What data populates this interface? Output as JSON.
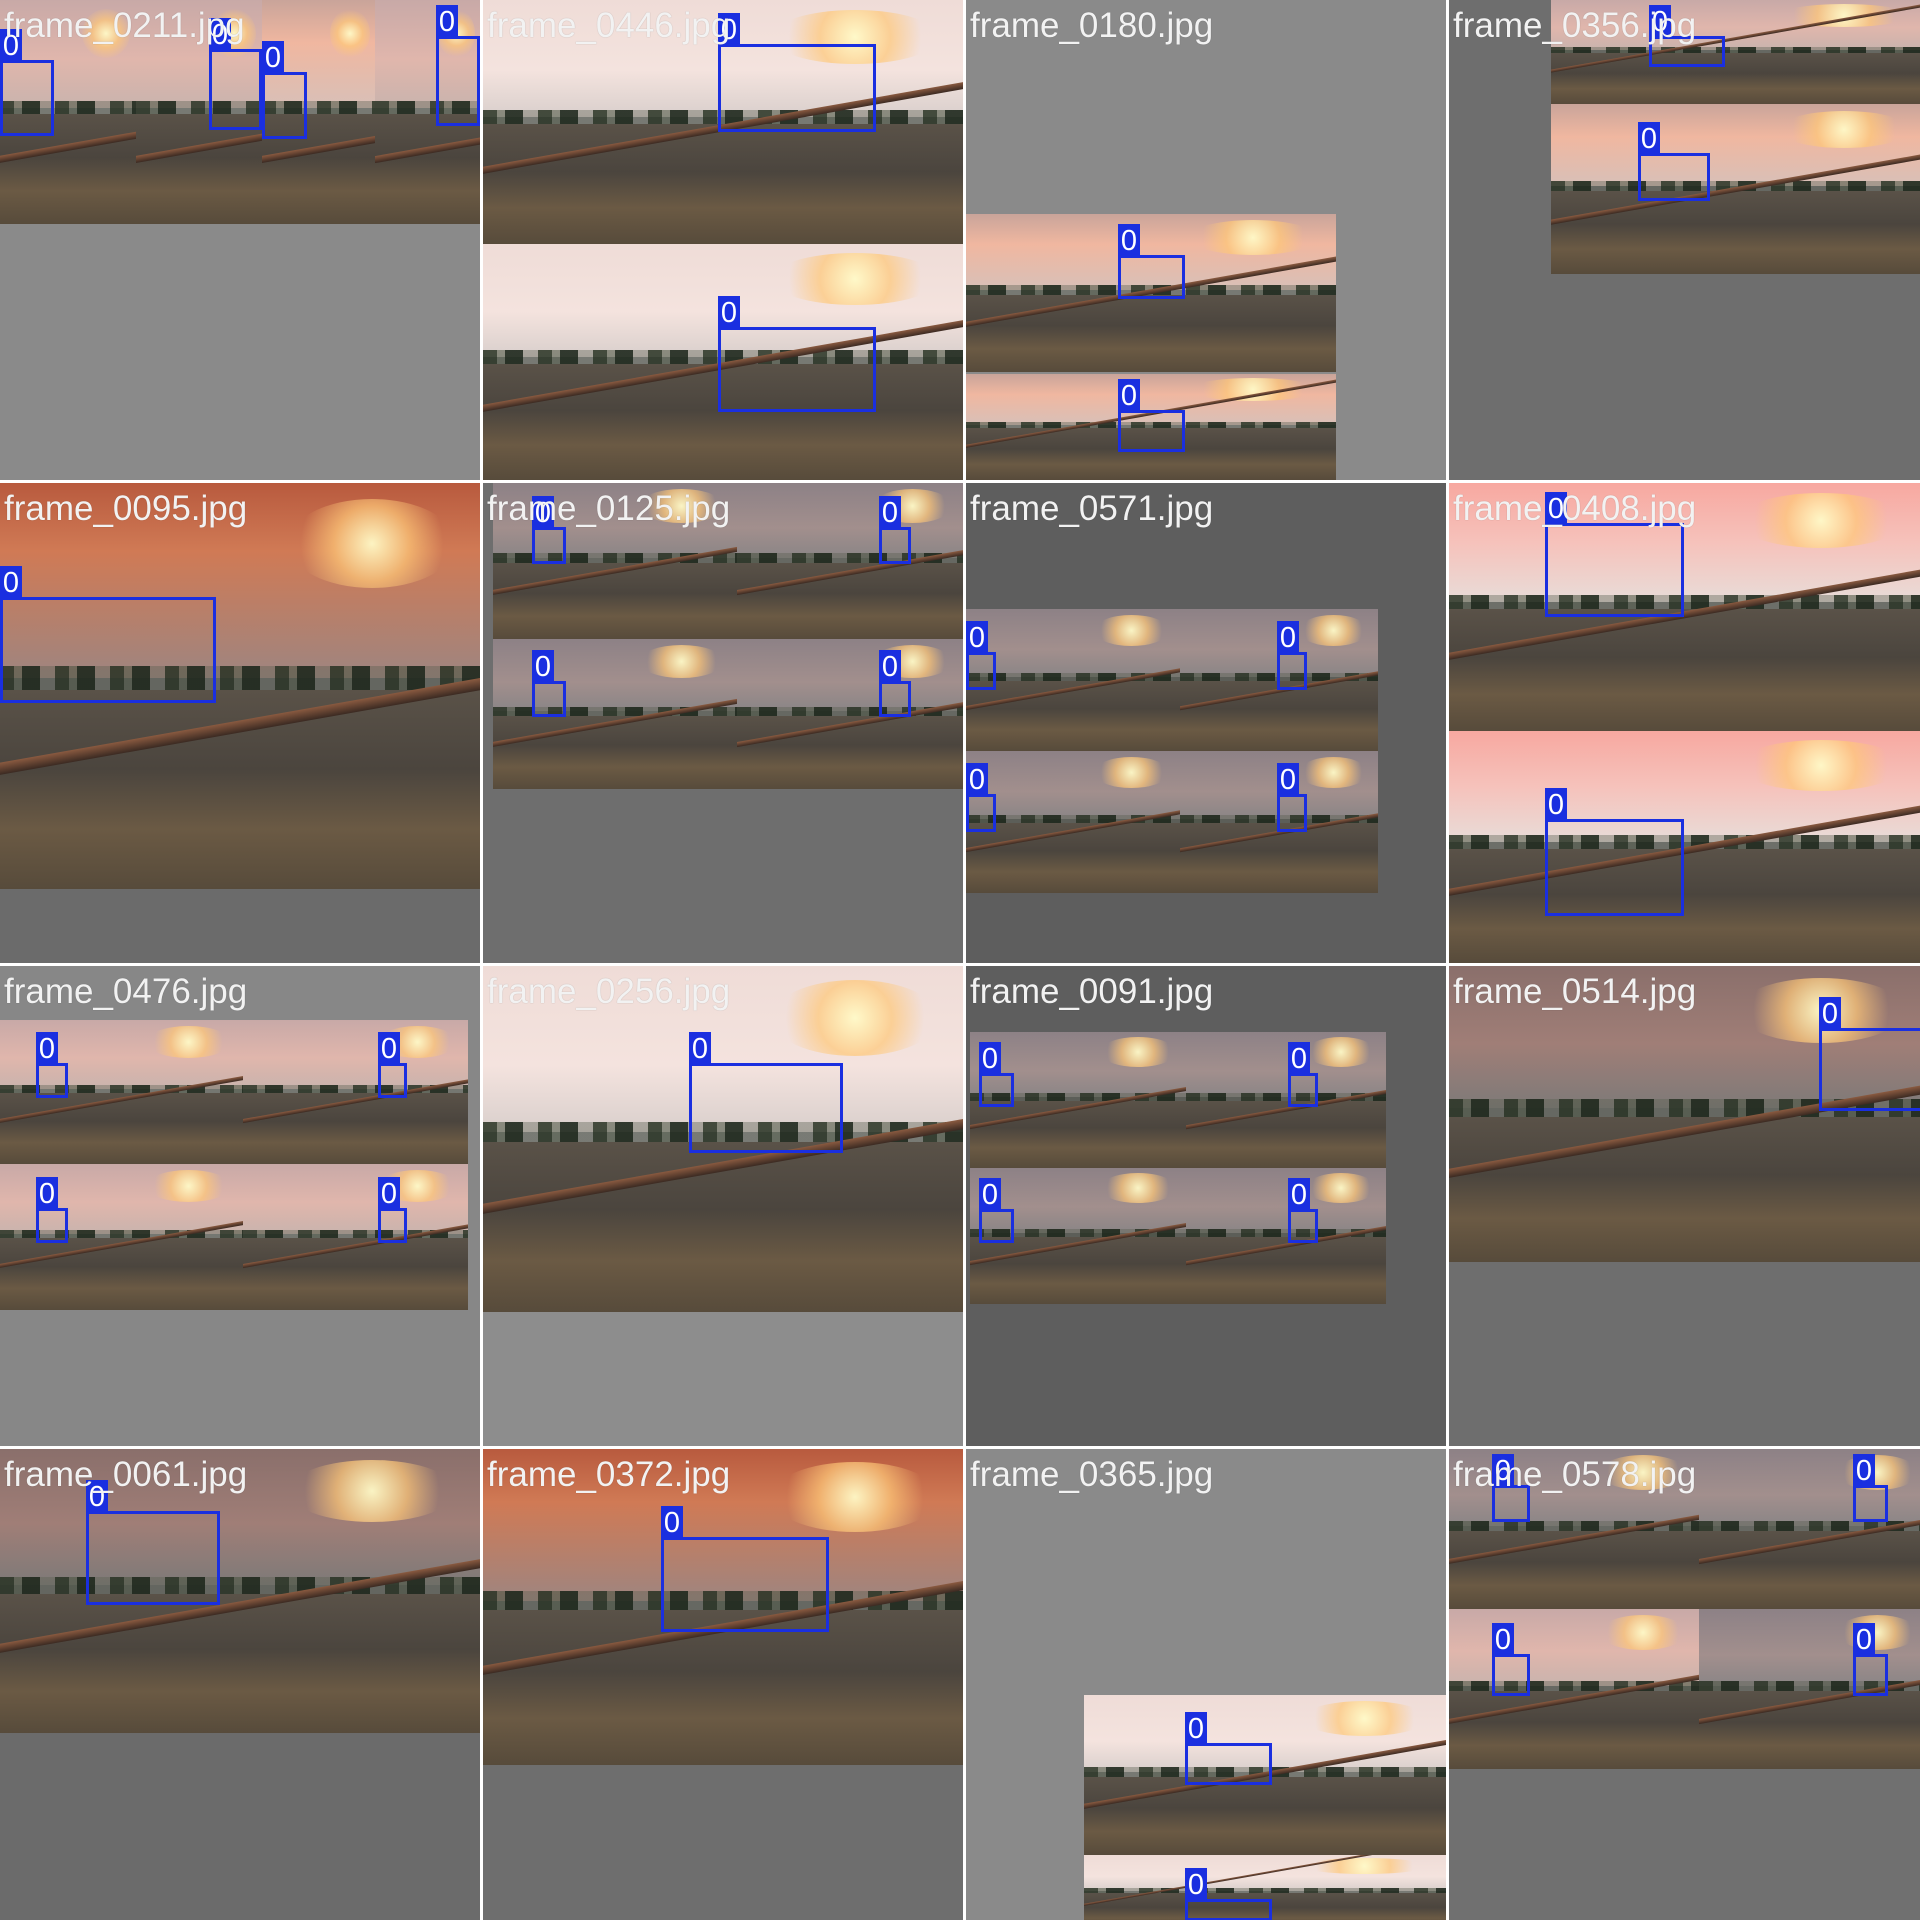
{
  "grid": {
    "columns": 4,
    "rows": 4,
    "tiles": [
      {
        "label": "frame_0211.jpg",
        "tint": "#8a8a8a",
        "photos": [
          {
            "sky": "warm",
            "boxes": [
              {
                "cls": "0"
              }
            ]
          },
          {
            "sky": "warm",
            "boxes": [
              {
                "cls": "0"
              }
            ]
          },
          {
            "sky": "sunset",
            "boxes": [
              {
                "cls": "0"
              }
            ]
          },
          {
            "sky": "warm",
            "boxes": [
              {
                "cls": "0"
              }
            ]
          }
        ]
      },
      {
        "label": "frame_0446.jpg",
        "tint": "#8a8a8a",
        "photos": [
          {
            "sky": "pale",
            "boxes": [
              {
                "cls": "0"
              }
            ]
          },
          {
            "sky": "pale",
            "boxes": [
              {
                "cls": "0"
              }
            ]
          }
        ]
      },
      {
        "label": "frame_0180.jpg",
        "tint": "#8a8a8a",
        "photos": [
          {
            "sky": "sunset",
            "boxes": [
              {
                "cls": "0"
              }
            ]
          },
          {
            "sky": "sunset",
            "boxes": [
              {
                "cls": "0"
              }
            ]
          }
        ]
      },
      {
        "label": "frame_0356.jpg",
        "tint": "#6e6e6e",
        "photos": [
          {
            "sky": "warm",
            "boxes": [
              {
                "cls": "0"
              }
            ]
          },
          {
            "sky": "sunset",
            "boxes": [
              {
                "cls": "0"
              }
            ]
          }
        ]
      },
      {
        "label": "frame_0095.jpg",
        "tint": "#6b6b6b",
        "photos": [
          {
            "sky": "red",
            "boxes": [
              {
                "cls": "0"
              }
            ]
          }
        ]
      },
      {
        "label": "frame_0125.jpg",
        "tint": "#6e6e6e",
        "photos": [
          {
            "sky": "gray",
            "boxes": [
              {
                "cls": "0"
              }
            ]
          },
          {
            "sky": "gray",
            "boxes": [
              {
                "cls": "0"
              }
            ]
          },
          {
            "sky": "gray",
            "boxes": [
              {
                "cls": "0"
              }
            ]
          },
          {
            "sky": "gray",
            "boxes": [
              {
                "cls": "0"
              }
            ]
          }
        ]
      },
      {
        "label": "frame_0571.jpg",
        "tint": "#5e5e5e",
        "photos": [
          {
            "sky": "gray",
            "boxes": [
              {
                "cls": "0"
              }
            ]
          },
          {
            "sky": "gray",
            "boxes": [
              {
                "cls": "0"
              }
            ]
          },
          {
            "sky": "gray",
            "boxes": [
              {
                "cls": "0"
              }
            ]
          },
          {
            "sky": "gray",
            "boxes": [
              {
                "cls": "0"
              }
            ]
          }
        ]
      },
      {
        "label": "frame_0408.jpg",
        "tint": "#7a7a7a",
        "photos": [
          {
            "sky": "pink",
            "boxes": [
              {
                "cls": "0"
              }
            ]
          },
          {
            "sky": "pink",
            "boxes": [
              {
                "cls": "0"
              }
            ]
          }
        ]
      },
      {
        "label": "frame_0476.jpg",
        "tint": "#878787",
        "photos": [
          {
            "sky": "warm",
            "boxes": [
              {
                "cls": "0"
              }
            ]
          },
          {
            "sky": "warm",
            "boxes": [
              {
                "cls": "0"
              }
            ]
          },
          {
            "sky": "warm",
            "boxes": [
              {
                "cls": "0"
              }
            ]
          },
          {
            "sky": "warm",
            "boxes": [
              {
                "cls": "0"
              }
            ]
          }
        ]
      },
      {
        "label": "frame_0256.jpg",
        "tint": "#8d8d8d",
        "photos": [
          {
            "sky": "pale",
            "boxes": [
              {
                "cls": "0"
              }
            ]
          }
        ]
      },
      {
        "label": "frame_0091.jpg",
        "tint": "#5e5e5e",
        "photos": [
          {
            "sky": "gray",
            "boxes": [
              {
                "cls": "0"
              }
            ]
          },
          {
            "sky": "gray",
            "boxes": [
              {
                "cls": "0"
              }
            ]
          },
          {
            "sky": "gray",
            "boxes": [
              {
                "cls": "0"
              }
            ]
          },
          {
            "sky": "gray",
            "boxes": [
              {
                "cls": "0"
              }
            ]
          }
        ]
      },
      {
        "label": "frame_0514.jpg",
        "tint": "#6e6e6e",
        "photos": [
          {
            "sky": "dusk",
            "boxes": [
              {
                "cls": "0"
              }
            ]
          }
        ]
      },
      {
        "label": "frame_0061.jpg",
        "tint": "#6b6b6b",
        "photos": [
          {
            "sky": "dusk",
            "boxes": [
              {
                "cls": "0"
              }
            ]
          }
        ]
      },
      {
        "label": "frame_0372.jpg",
        "tint": "#6e6e6e",
        "photos": [
          {
            "sky": "red",
            "boxes": [
              {
                "cls": "0"
              }
            ]
          }
        ]
      },
      {
        "label": "frame_0365.jpg",
        "tint": "#8a8a8a",
        "photos": [
          {
            "sky": "pale",
            "boxes": [
              {
                "cls": "0"
              }
            ]
          },
          {
            "sky": "pale",
            "boxes": [
              {
                "cls": "0"
              }
            ]
          }
        ]
      },
      {
        "label": "frame_0578.jpg",
        "tint": "#707070",
        "photos": [
          {
            "sky": "gray",
            "boxes": [
              {
                "cls": "0"
              }
            ]
          },
          {
            "sky": "gray",
            "boxes": [
              {
                "cls": "0"
              }
            ]
          },
          {
            "sky": "warm",
            "boxes": [
              {
                "cls": "0"
              }
            ]
          },
          {
            "sky": "gray",
            "boxes": [
              {
                "cls": "0"
              }
            ]
          }
        ]
      }
    ]
  },
  "colors": {
    "box": "#1a2fe0",
    "label_text": "#f2f2f2"
  }
}
